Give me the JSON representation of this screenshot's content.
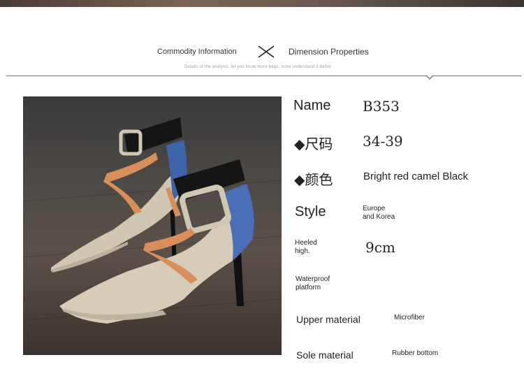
{
  "header": {
    "left_title": "Commodity Information",
    "right_title": "Dimension Properties",
    "subtitle": "Details of the analysis, let you know more bags, more understand it better"
  },
  "product_image": {
    "icon": "high-heel-shoe-photo"
  },
  "specs": [
    {
      "label": "Name",
      "value": "B353"
    },
    {
      "label": "◆尺码",
      "value": "34-39"
    },
    {
      "label": "◆颜色",
      "value": "Bright red camel Black"
    },
    {
      "label": "Style",
      "value_line1": "Europe",
      "value_line2": "and Korea"
    },
    {
      "label_line1": "Heeled",
      "label_line2": "high.",
      "value": "9cm"
    },
    {
      "label_line1": "Waterproof",
      "label_line2": "platform",
      "value": ""
    },
    {
      "label": "Upper material",
      "value": "Microfiber"
    },
    {
      "label": "Sole material",
      "value": "Rubber bottom"
    }
  ],
  "colors": {
    "divider": "#777777",
    "text": "#222222",
    "muted": "#999999"
  }
}
